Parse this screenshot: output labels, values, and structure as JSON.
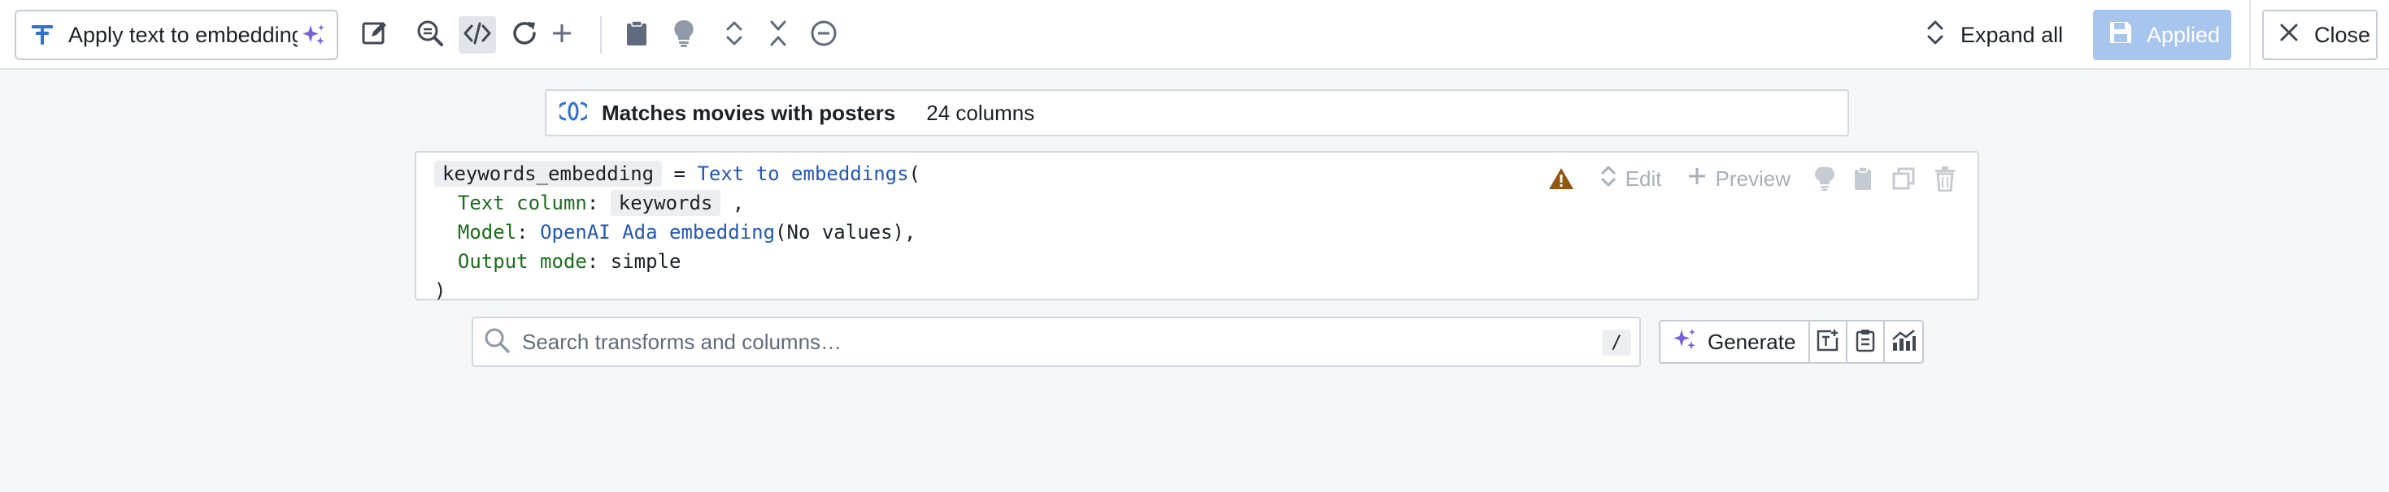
{
  "toolbar": {
    "title": "Apply text to embeddings",
    "icons": [
      "filter-icon",
      "sparkle-icon",
      "edit-icon",
      "search-zoom-icon",
      "code-icon",
      "refresh-icon",
      "plus-icon",
      "clipboard-icon",
      "lightbulb-icon",
      "expand-icon",
      "collapse-icon",
      "minus-circle-icon"
    ],
    "expand_all_label": "Expand all",
    "applied_label": "Applied",
    "close_label": "Close"
  },
  "dataset": {
    "name": "Matches movies with posters",
    "columns": "24 columns"
  },
  "transform": {
    "output_column": "keywords_embedding",
    "equals": " = ",
    "function": "Text to embeddings",
    "open_paren": "(",
    "text_column_label": "Text column",
    "text_column_value": "keywords",
    "model_label": "Model",
    "model_value": "OpenAI Ada embedding",
    "model_args": "(No values),",
    "output_mode_label": "Output mode",
    "output_mode_value": "simple",
    "close_paren": ")",
    "actions": {
      "edit": "Edit",
      "preview": "Preview"
    }
  },
  "search": {
    "placeholder": "Search transforms and columns…",
    "shortcut": "/"
  },
  "generate": {
    "label": "Generate"
  },
  "colors": {
    "accent_blue": "#2d72d2",
    "applied_bg": "#a8c5ee",
    "sparkle_purple": "#7961db",
    "warning": "#935610",
    "code_green": "#1c6e1c",
    "code_blue": "#2458b3"
  }
}
